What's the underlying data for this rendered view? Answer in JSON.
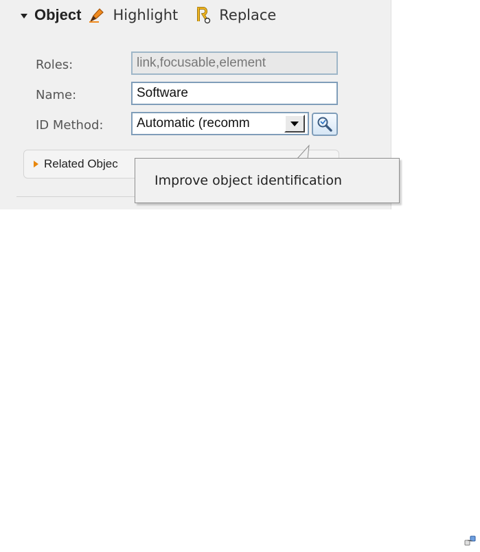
{
  "object_panel": {
    "title": "Object",
    "actions": {
      "highlight_label": "Highlight",
      "replace_label": "Replace"
    },
    "fields": {
      "roles": {
        "label": "Roles:",
        "value": "link,focusable,element"
      },
      "name": {
        "label": "Name:",
        "value": "Software"
      },
      "id_method": {
        "label": "ID Method:",
        "selected": "Automatic (recomm"
      }
    },
    "related_objects_label": "Related Objec"
  },
  "tooltip": {
    "text": "Improve object identification"
  },
  "colors": {
    "panel_bg": "#f0f0f0",
    "input_border": "#7f9db9",
    "expander_accent": "#e8870c",
    "highlight_icon": "#f08a1e",
    "replace_icon": "#f0b420"
  },
  "icons": {
    "collapse": "triangle-down-icon",
    "highlight": "highlighter-pen-icon",
    "replace": "replace-icon",
    "improve": "magnifier-icon",
    "expand": "triangle-right-icon",
    "corner": "network-icon"
  }
}
